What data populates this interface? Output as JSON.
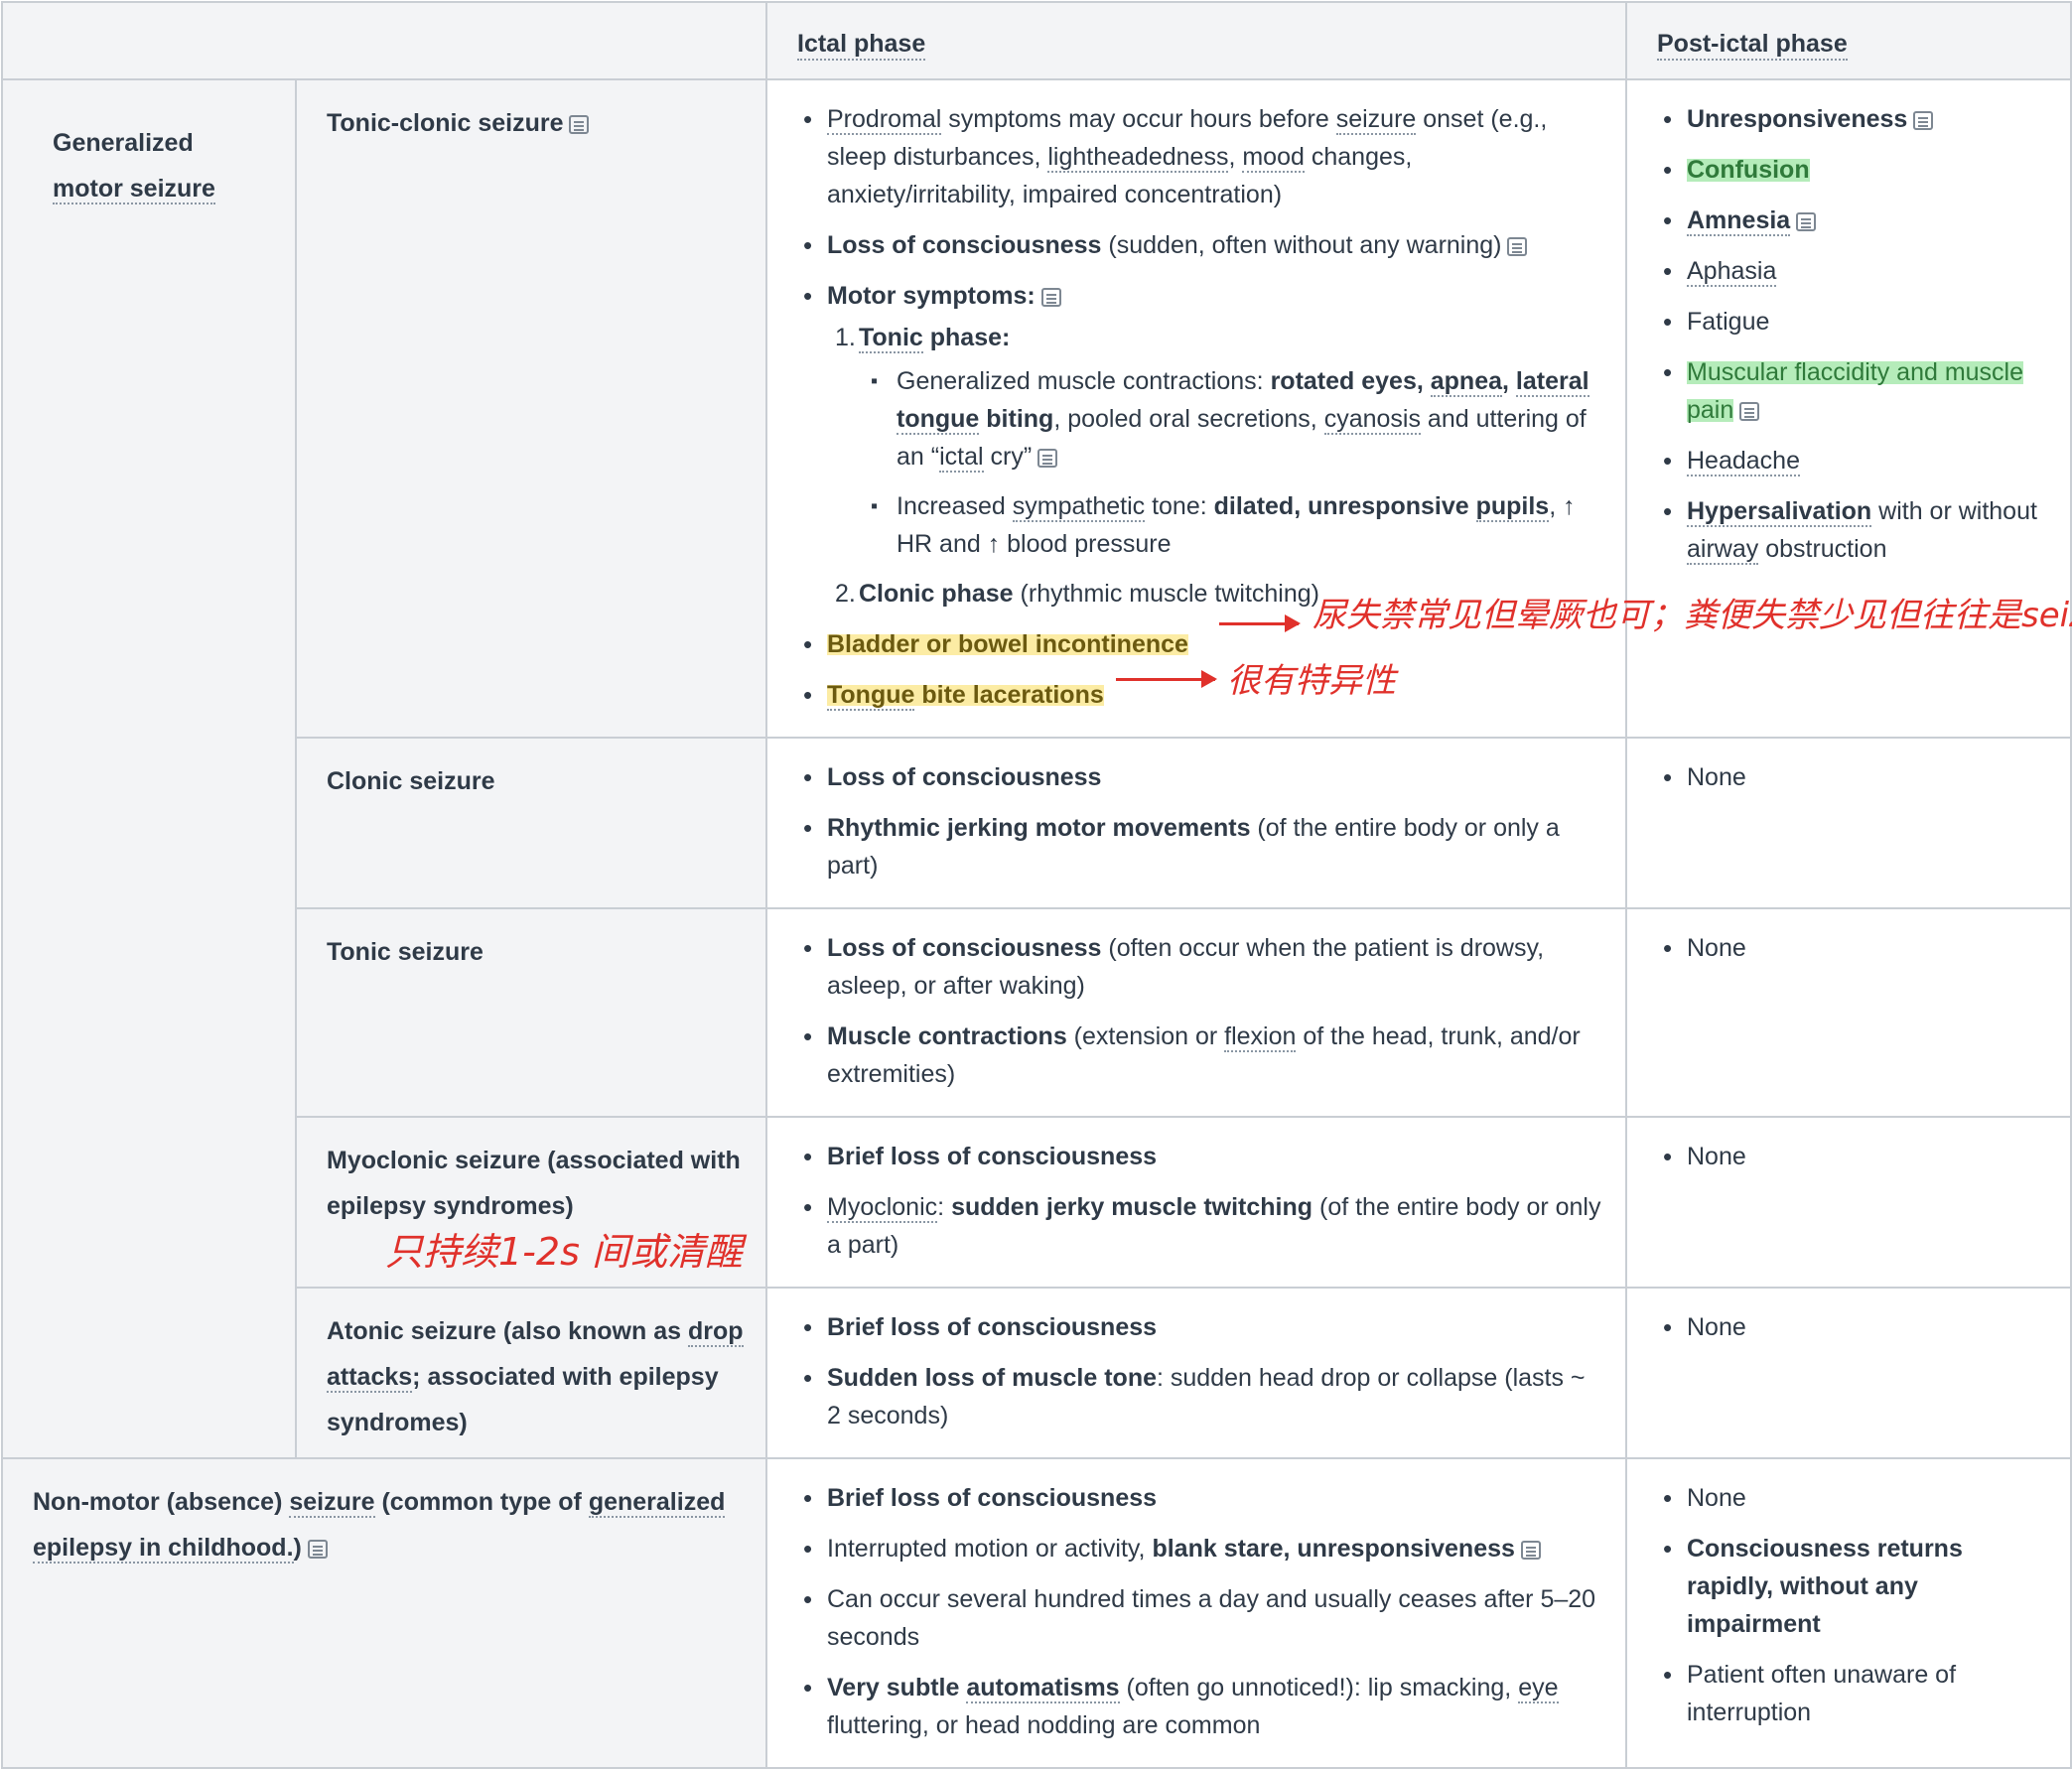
{
  "headers": {
    "ictal": "Ictal phase",
    "postictal": "Post-ictal phase"
  },
  "generalized": {
    "label_line1": "Generalized",
    "label_line2": "motor seizure"
  },
  "tonic_clonic": {
    "name": "Tonic-clonic seizure",
    "ictal": {
      "prodromal": "Prodromal",
      "prodromal_rest1": " symptoms may occur hours before ",
      "seizure": "seizure",
      "prodromal_rest2": " onset (e.g., sleep disturbances, ",
      "lightheadedness": "lightheadedness",
      "comma": ", ",
      "mood": "mood",
      "prodromal_rest3": " changes, anxiety/irritability, impaired concentration)",
      "loc_bold": "Loss of consciousness",
      "loc_rest": " (sudden, often without any warning)",
      "motor_bold": "Motor symptoms:",
      "tonic_num": "1.",
      "tonic_word": "Tonic",
      "tonic_phase": " phase:",
      "gen_contr": "Generalized muscle contractions: ",
      "rotated": "rotated eyes, ",
      "apnea": "apnea",
      "comma2": ", ",
      "lateral": "lateral tongue",
      "biting": " biting",
      "pooled": ", pooled oral secretions, ",
      "cyanosis": "cyanosis",
      "uttering": " and uttering of an “",
      "ictal_word": "ictal",
      "cry": " cry”",
      "increased": "Increased ",
      "sympathetic": "sympathetic",
      "tone": " tone: ",
      "dilated": "dilated, unresponsive ",
      "pupils": "pupils",
      "hr": ", ↑ HR and ↑ blood pressure",
      "clonic_num": "2.",
      "clonic_bold": "Clonic phase",
      "clonic_rest": " (rhythmic muscle twitching)",
      "bladder": "Bladder or bowel incontinence",
      "tongue_word": "Tongue",
      "bite": " bite lacerations"
    },
    "post": {
      "unresp": "Unresponsiveness",
      "confusion": "Confusion",
      "amnesia": "Amnesia",
      "aphasia": "Aphasia",
      "fatigue": "Fatigue",
      "flaccid": "Muscular flaccidity and muscle pain",
      "headache": "Headache",
      "hypersal": "Hypersalivation",
      "hypersal_rest1": " with or without ",
      "airway": "airway",
      "hypersal_rest2": " obstruction"
    }
  },
  "clonic": {
    "name": "Clonic seizure",
    "loc": "Loss of consciousness",
    "rhythmic": "Rhythmic jerking motor movements",
    "rhythmic_rest": " (of the entire body or only a part)",
    "post": "None"
  },
  "tonic": {
    "name": "Tonic seizure",
    "loc": "Loss of consciousness",
    "loc_rest": " (often occur when the patient is drowsy, asleep, or after waking)",
    "muscle": "Muscle contractions",
    "muscle_rest1": " (extension or ",
    "flexion": "flexion",
    "muscle_rest2": " of the head, trunk, and/or extremities)",
    "post": "None"
  },
  "myoclonic": {
    "name": "Myoclonic seizure (associated with epilepsy syndromes)",
    "brief": "Brief loss of consciousness",
    "myo": "Myoclonic",
    "colon": ": ",
    "sudden": "sudden jerky muscle twitching",
    "sudden_rest": " (of the entire body or only a part)",
    "post": "None"
  },
  "atonic": {
    "name_pre": "Atonic seizure (also known as ",
    "drop": "drop attacks",
    "name_post": "; associated with epilepsy syndromes)",
    "brief": "Brief loss of consciousness",
    "sudden": "Sudden loss of muscle tone",
    "sudden_rest": ": sudden head drop or collapse (lasts ~ 2 seconds)",
    "post": "None"
  },
  "absence": {
    "name_pre": "Non-motor (absence) ",
    "seizure": "seizure",
    "name_mid": " (common type of ",
    "generalized": "generalized epilepsy in childhood.",
    "name_post": ")",
    "brief": "Brief loss of consciousness",
    "interrupted": "Interrupted motion or activity, ",
    "blank": "blank stare, ",
    "unresp": "unresponsiveness",
    "several": "Can occur several hundred times a day and usually ceases after 5–20 seconds",
    "subtle": "Very subtle ",
    "automatisms": "automatisms",
    "subtle_rest1": " (often go unnoticed!): lip smacking, ",
    "eye": "eye",
    "subtle_rest2": " fluttering, or head nodding are common",
    "post_none": "None",
    "post_returns": "Consciousness returns rapidly, without any impairment",
    "post_unaware": "Patient often unaware of interruption"
  },
  "annotations": {
    "bladder_note": "尿失禁常见但晕厥也可；粪便失禁少见但往往是seizure",
    "tongue_note": "很有特异性",
    "myoclonic_note": "只持续1-2s 间或清醒"
  },
  "colors": {
    "annotation": "#e0312b",
    "highlight_yellow": "#fadc5a",
    "highlight_green": "#78dc82",
    "header_bg": "#f3f4f6"
  }
}
